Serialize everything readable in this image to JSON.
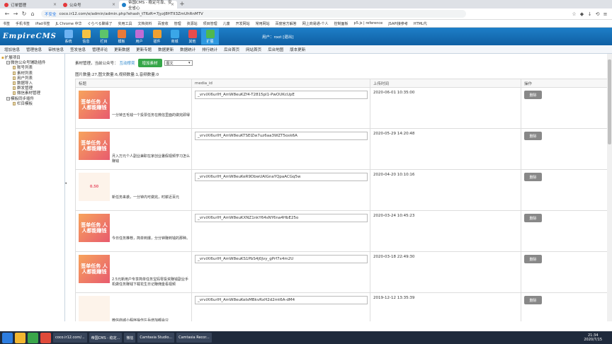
{
  "tabs": [
    {
      "label": "订单管理",
      "active": false
    },
    {
      "label": "公众号",
      "active": false
    },
    {
      "label": "帝国CMS - 稳定可靠、安全省心",
      "active": true
    }
  ],
  "address": {
    "security": "不安全",
    "url": "coco.ir12.com/e/admin/admin.php?ehash_tT6zR=7jyzJ8HTII3ZmUhRnMTV"
  },
  "bookmarks": [
    "书签",
    "手机书签",
    "iPad书签",
    "JL Chrome 中华",
    "ぐらべる聚緣了",
    "实用工具",
    "文档资料",
    "百度收",
    "管理",
    "资源站",
    "项目管理",
    "儿童",
    "开发网站",
    "常用网站",
    "百度官方解答",
    "网上商易通-个人",
    "控制面板",
    "p5.js | reference",
    "JSAPI接参考",
    "HTML代"
  ],
  "cms": {
    "logo": "EmpireCMS",
    "top_icons": [
      {
        "label": "系统",
        "color": "#6db3f2"
      },
      {
        "label": "信息",
        "color": "#f5c243"
      },
      {
        "label": "栏目",
        "color": "#5ec46a"
      },
      {
        "label": "模板",
        "color": "#e87a3a"
      },
      {
        "label": "用户",
        "color": "#c06cd4"
      },
      {
        "label": "插件",
        "color": "#f0a030"
      },
      {
        "label": "商城",
        "color": "#3aa6e8"
      },
      {
        "label": "其他",
        "color": "#e84c4c"
      },
      {
        "label": "扩展",
        "color": "#4fb84f"
      }
    ],
    "user_label": "用户：root [退出]"
  },
  "menu": [
    "增加信息",
    "管理信息",
    "审核信息",
    "签发信息",
    "管理评论",
    "更新数据",
    "更新专题",
    "数据更新",
    "数据统计",
    "排行统计",
    "后台首页",
    "网站首页",
    "后台地图",
    "版本更新"
  ],
  "tree": [
    {
      "label": "扩展项目",
      "level": 0,
      "fold": false
    },
    {
      "label": "微信公众号辅助插件",
      "level": 1,
      "fold": true
    },
    {
      "label": "账号列表",
      "level": 2
    },
    {
      "label": "素材列表",
      "level": 2
    },
    {
      "label": "用户列表",
      "level": 2
    },
    {
      "label": "数据导入",
      "level": 2
    },
    {
      "label": "群发管理",
      "level": 2
    },
    {
      "label": "微信素材管理",
      "level": 2
    },
    {
      "label": "模板同步插件",
      "level": 1,
      "fold": true
    },
    {
      "label": "栏目模板",
      "level": 2
    }
  ],
  "filter": {
    "prefix": "素材管理，当前公众号：",
    "account": "互动撑奕",
    "add_button": "增加素材",
    "type_select": "图文"
  },
  "stats": "图片数量:27,图文数量:6,视频数量:1,音频数量:0",
  "table": {
    "headers": [
      "标题",
      "media_id",
      "上传时间",
      "操作"
    ],
    "rows": [
      {
        "thumb": "签单任务 人人都能赚钱",
        "thumb_style": "bold",
        "title": "一分钟五毛钱一个投票任务在微信里面的做完即得",
        "media_id": "_vrviXl6urlH_AmW8euKZf4-T2815pl1-PwOUKcUpE",
        "time": "2020-06-01 10:35:00",
        "action": "删除"
      },
      {
        "thumb": "签单任务 人人都能赚钱",
        "thumb_style": "bold",
        "title": "月入万元个人副业兼职在家创业暑假视频学习怎么赚钱",
        "media_id": "_vrviXl6urlH_AmW8euKTSEIZw7uz6aa3WZT5oxk6A",
        "time": "2020-05-29 14:20:48",
        "action": "删除"
      },
      {
        "thumb": "0.50",
        "thumb_style": "light",
        "title": "新任务来袭，一分钟内可做完，时薪近百元",
        "media_id": "_vrviXl6urlH_AmW8euKeR9DbwUAIGnaYQpaACGq5w",
        "time": "2020-04-20 10:10:16",
        "action": "删除"
      },
      {
        "thumb": "签单任务 人人都能赚钱",
        "thumb_style": "bold",
        "title": "今日任务推荐，简单到爆，分分钟赚到钱的那种。",
        "media_id": "_vrviXl6urlH_AmW8euKXNZ1nkY64sNY6na4HbE25o",
        "time": "2020-03-24 10:45:23",
        "action": "删除"
      },
      {
        "thumb": "签单任务 人人都能赚钱",
        "thumb_style": "bold",
        "title": "2.5元新用户专享简单任务宝妈零投资赚钱副业手机做任务赚钱下载花生日记赚佣金看视频",
        "media_id": "_vrviXl6urlH_AmW8euKS1PbS4j0Jvy_gPrf7x4m2U",
        "time": "2020-03-18 22:49:30",
        "action": "删除"
      },
      {
        "thumb": "",
        "thumb_style": "light",
        "title": "微信商城小程序操作左兵增加都会只",
        "media_id": "_vrviXl6urlH_AmW8euKeIsMBkvRxH2d2mt6A-dM4",
        "time": "2019-12-12 13:35:39",
        "action": "删除"
      }
    ]
  },
  "taskbar": {
    "windows": [
      "coco.ir12.com/...",
      "帝国CMS - 稳定...",
      "微信",
      "Camtasia Studio...",
      "Camtasia Recor..."
    ],
    "time": "21:34",
    "date": "2020/7/15"
  }
}
